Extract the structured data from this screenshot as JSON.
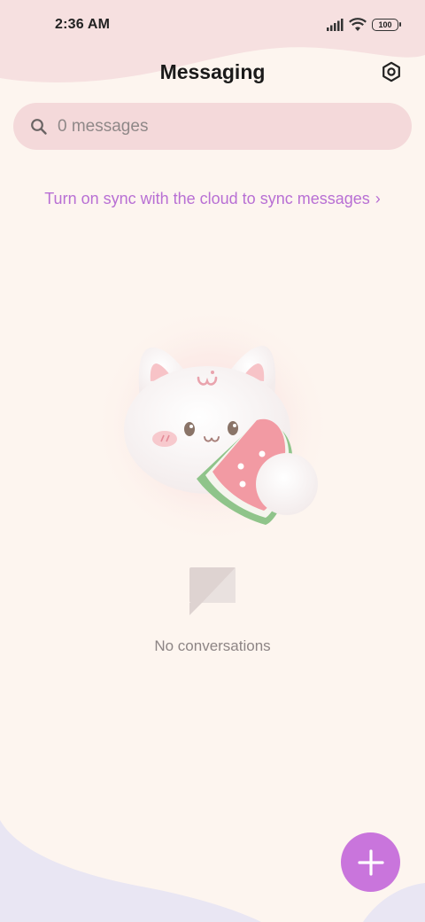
{
  "status_bar": {
    "time": "2:36 AM",
    "battery": "100",
    "icons": [
      "signal-icon",
      "wifi-icon",
      "battery-icon"
    ]
  },
  "header": {
    "title": "Messaging",
    "settings_icon": "gear-icon"
  },
  "search": {
    "placeholder": "0 messages",
    "icon": "search-icon"
  },
  "sync_banner": {
    "text": "Turn on sync with the cloud to sync messages",
    "chevron": "›"
  },
  "empty_state": {
    "illustration": "cat-mascot-with-watermelon",
    "icon": "chat-bubble-icon",
    "text": "No conversations"
  },
  "fab": {
    "icon": "plus-icon",
    "color": "#c975dc"
  },
  "colors": {
    "background": "#fdf5ef",
    "accent": "#b86fd4",
    "search_bg": "#f4d9da",
    "top_blob": "#f6e0e0",
    "bottom_blob": "#e9e6f3"
  }
}
